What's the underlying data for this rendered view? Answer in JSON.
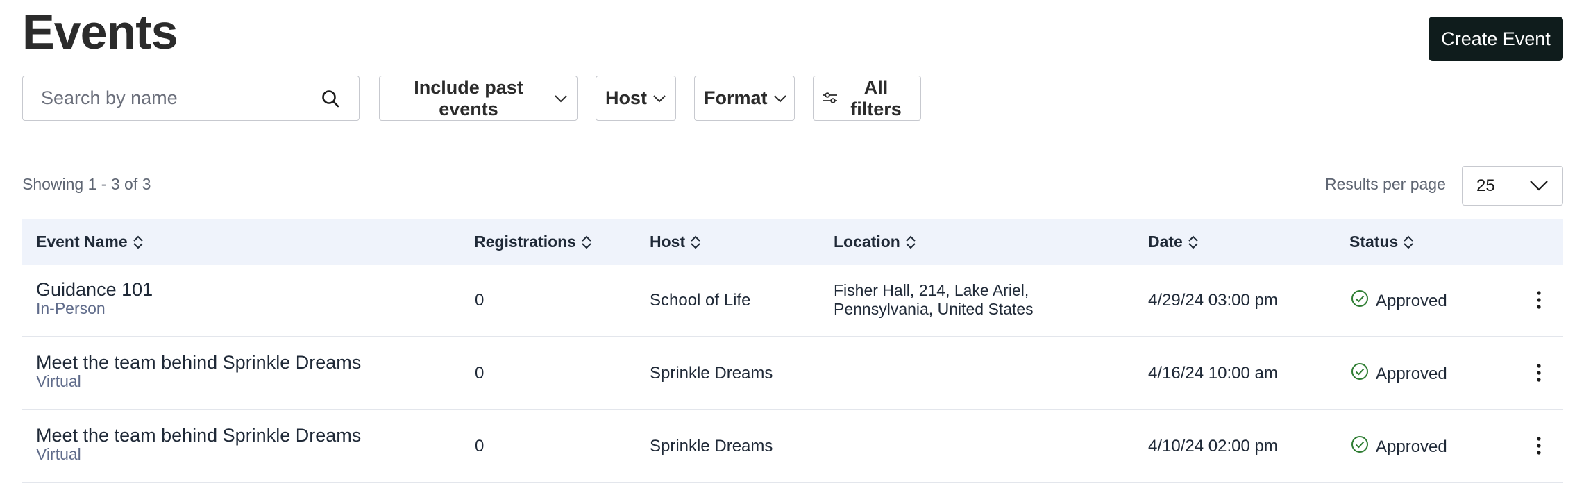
{
  "header": {
    "title": "Events",
    "create_label": "Create Event"
  },
  "filters": {
    "search_placeholder": "Search by name",
    "past_events_label": "Include past events",
    "host_label": "Host",
    "format_label": "Format",
    "all_filters_label": "All filters"
  },
  "results": {
    "showing_text": "Showing 1 - 3 of 3",
    "per_page_label": "Results per page",
    "per_page_value": "25"
  },
  "table": {
    "columns": [
      "Event Name",
      "Registrations",
      "Host",
      "Location",
      "Date",
      "Status"
    ],
    "rows": [
      {
        "name": "Guidance 101",
        "format": "In-Person",
        "registrations": "0",
        "host": "School of Life",
        "location_line1": "Fisher Hall, 214, Lake Ariel,",
        "location_line2": "Pennsylvania, United States",
        "date": "4/29/24 03:00 pm",
        "status": "Approved"
      },
      {
        "name": "Meet the team behind Sprinkle Dreams",
        "format": "Virtual",
        "registrations": "0",
        "host": "Sprinkle Dreams",
        "location_line1": "",
        "location_line2": "",
        "date": "4/16/24 10:00 am",
        "status": "Approved"
      },
      {
        "name": "Meet the team behind Sprinkle Dreams",
        "format": "Virtual",
        "registrations": "0",
        "host": "Sprinkle Dreams",
        "location_line1": "",
        "location_line2": "",
        "date": "4/10/24 02:00 pm",
        "status": "Approved"
      }
    ]
  },
  "colors": {
    "primary_button": "#0f1c1c",
    "header_bg": "#eff3fb",
    "status_approved": "#2e7d32",
    "muted_text": "#5f6673"
  }
}
